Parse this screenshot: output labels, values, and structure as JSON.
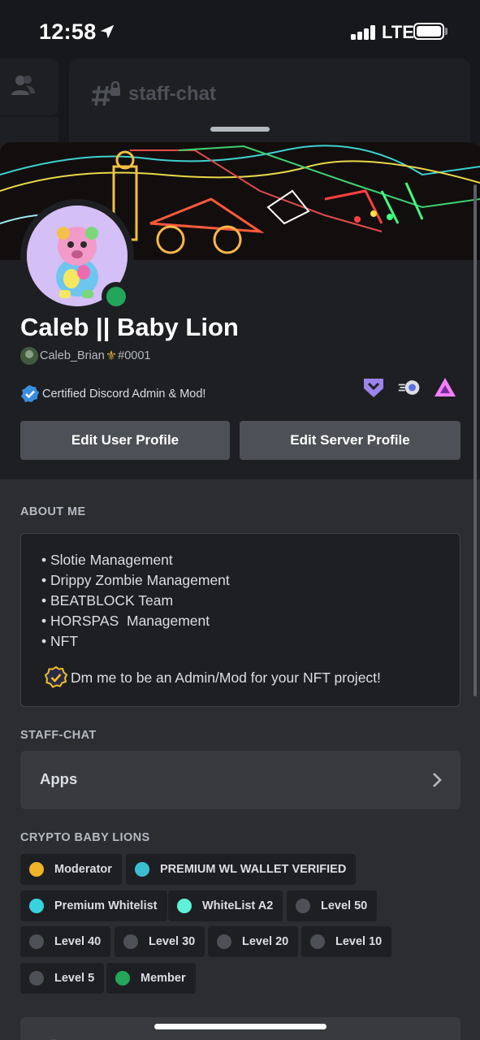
{
  "status_bar": {
    "time": "12:58",
    "network": "LTE"
  },
  "background": {
    "channel_name": "staff-chat"
  },
  "profile": {
    "display_name": "Caleb || Baby Lion",
    "username": "Caleb_Brian",
    "discriminator": "#0001",
    "custom_status": "Certified Discord Admin & Mod!",
    "status_color": "#23a55a",
    "badges": [
      "hypesquad-balance-badge",
      "nitro-boost-badge",
      "triangle-badge"
    ]
  },
  "buttons": {
    "edit_user": "Edit User Profile",
    "edit_server": "Edit Server Profile"
  },
  "about": {
    "title": "ABOUT ME",
    "lines": [
      "• Slotie Management",
      "• Drippy Zombie Management",
      "• BEATBLOCK Team",
      "• HORSPAS  Management",
      "• NFT"
    ],
    "cta": "Dm me to be an Admin/Mod for your NFT project!"
  },
  "channel_section": {
    "title": "STAFF-CHAT",
    "apps_label": "Apps"
  },
  "roles_section": {
    "title": "CRYPTO BABY LIONS",
    "roles": [
      {
        "name": "Moderator",
        "color": "#f0b429"
      },
      {
        "name": "PREMIUM WL WALLET VERIFIED",
        "color": "#3bbfd0"
      },
      {
        "name": "Premium Whitelist",
        "color": "#35d4e0"
      },
      {
        "name": "WhiteList A2",
        "color": "#5ef2d8"
      },
      {
        "name": "Level 50",
        "color": "#4e5058"
      },
      {
        "name": "Level 40",
        "color": "#4e5058"
      },
      {
        "name": "Level 30",
        "color": "#4e5058"
      },
      {
        "name": "Level 20",
        "color": "#4e5058"
      },
      {
        "name": "Level 10",
        "color": "#4e5058"
      },
      {
        "name": "Level 5",
        "color": "#4e5058"
      },
      {
        "name": "Member",
        "color": "#23a55a"
      }
    ]
  }
}
